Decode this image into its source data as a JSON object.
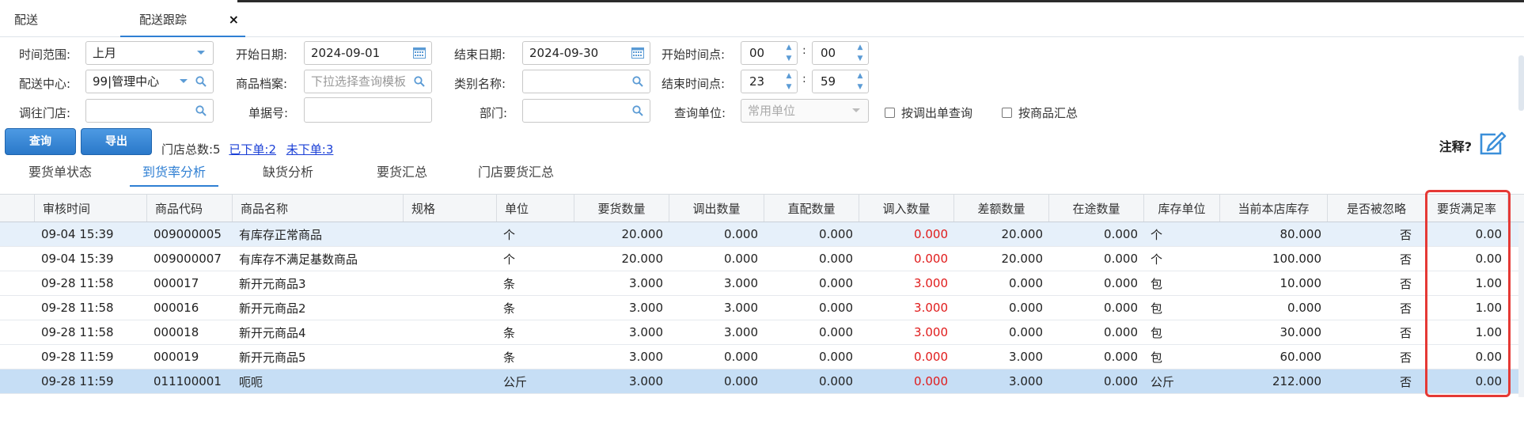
{
  "tabs": {
    "tab1": "配送",
    "tab2": "配送跟踪",
    "close": "×"
  },
  "form": {
    "time_range_label": "时间范围:",
    "time_range_value": "上月",
    "start_date_label": "开始日期:",
    "start_date_value": "2024-09-01",
    "end_date_label": "结束日期:",
    "end_date_value": "2024-09-30",
    "start_time_label": "开始时间点:",
    "start_hour": "00",
    "start_minute": "00",
    "center_label": "配送中心:",
    "center_value": "99|管理中心",
    "product_label": "商品档案:",
    "product_placeholder": "下拉选择查询模板",
    "category_label": "类别名称:",
    "end_time_label": "结束时间点:",
    "end_hour": "23",
    "end_minute": "59",
    "store_label": "调往门店:",
    "doc_label": "单据号:",
    "dept_label": "部门:",
    "unit_label": "查询单位:",
    "unit_value": "常用单位",
    "chk_out": "按调出单查询",
    "chk_goods": "按商品汇总",
    "colon": ":"
  },
  "actions": {
    "query": "查询",
    "export": "导出",
    "store_total": "门店总数:5",
    "ordered": "已下单:2",
    "not_ordered": "未下单:3",
    "note": "注释?"
  },
  "subtabs": [
    "要货单状态",
    "到货率分析",
    "缺货分析",
    "要货汇总",
    "门店要货汇总"
  ],
  "table": {
    "headers": [
      "审核时间",
      "商品代码",
      "商品名称",
      "规格",
      "单位",
      "要货数量",
      "调出数量",
      "直配数量",
      "调入数量",
      "差额数量",
      "在途数量",
      "库存单位",
      "当前本店库存",
      "是否被忽略",
      "要货满足率"
    ],
    "rows": [
      [
        "09-04 15:39",
        "009000005",
        "有库存正常商品",
        "",
        "个",
        "20.000",
        "0.000",
        "0.000",
        "0.000",
        "20.000",
        "0.000",
        "个",
        "80.000",
        "否",
        "0.00"
      ],
      [
        "09-04 15:39",
        "009000007",
        "有库存不满足基数商品",
        "",
        "个",
        "20.000",
        "0.000",
        "0.000",
        "0.000",
        "20.000",
        "0.000",
        "个",
        "100.000",
        "否",
        "0.00"
      ],
      [
        "09-28 11:58",
        "000017",
        "新开元商品3",
        "",
        "条",
        "3.000",
        "3.000",
        "0.000",
        "3.000",
        "0.000",
        "0.000",
        "包",
        "10.000",
        "否",
        "1.00"
      ],
      [
        "09-28 11:58",
        "000016",
        "新开元商品2",
        "",
        "条",
        "3.000",
        "3.000",
        "0.000",
        "3.000",
        "0.000",
        "0.000",
        "包",
        "0.000",
        "否",
        "1.00"
      ],
      [
        "09-28 11:58",
        "000018",
        "新开元商品4",
        "",
        "条",
        "3.000",
        "3.000",
        "0.000",
        "3.000",
        "0.000",
        "0.000",
        "包",
        "30.000",
        "否",
        "1.00"
      ],
      [
        "09-28 11:59",
        "000019",
        "新开元商品5",
        "",
        "条",
        "3.000",
        "0.000",
        "0.000",
        "0.000",
        "3.000",
        "0.000",
        "包",
        "60.000",
        "否",
        "0.00"
      ],
      [
        "09-28 11:59",
        "011100001",
        "呃呃",
        "",
        "公斤",
        "3.000",
        "0.000",
        "0.000",
        "0.000",
        "3.000",
        "0.000",
        "公斤",
        "212.000",
        "否",
        "0.00"
      ]
    ]
  },
  "colors": {
    "accent": "#2f7fd3",
    "highlight": "#e53935",
    "negative": "#e01b1b"
  }
}
